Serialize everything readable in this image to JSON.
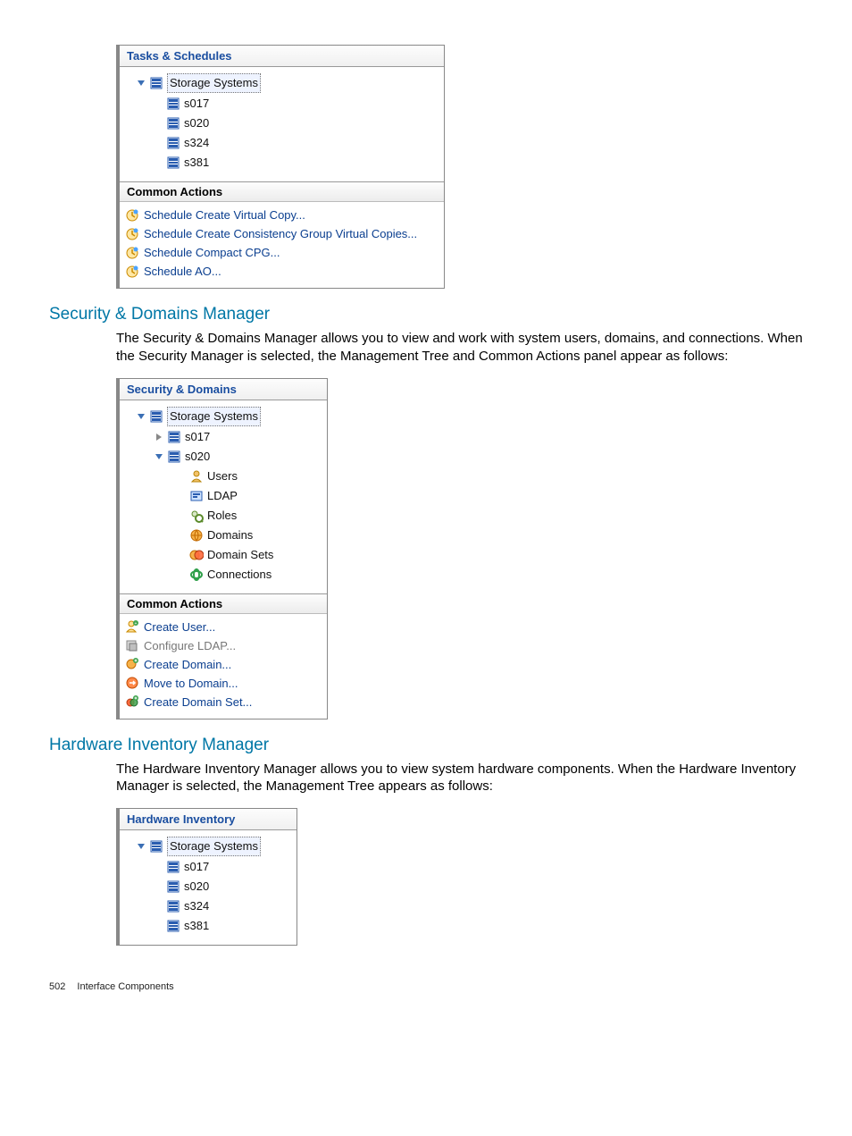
{
  "panel1": {
    "title": "Tasks & Schedules",
    "root": "Storage Systems",
    "children": [
      "s017",
      "s020",
      "s324",
      "s381"
    ],
    "actions_title": "Common Actions",
    "actions": [
      "Schedule Create Virtual Copy...",
      "Schedule Create Consistency Group Virtual Copies...",
      "Schedule Compact CPG...",
      "Schedule AO..."
    ]
  },
  "heading1": "Security & Domains Manager",
  "para1": "The Security & Domains Manager allows you to view and work with system users, domains, and connections. When the Security Manager is selected, the Management Tree and Common Actions panel appear as follows:",
  "panel2": {
    "title": "Security & Domains",
    "root": "Storage Systems",
    "child1": "s017",
    "child2": "s020",
    "sub": [
      "Users",
      "LDAP",
      "Roles",
      "Domains",
      "Domain Sets",
      "Connections"
    ],
    "actions_title": "Common Actions",
    "actions": [
      {
        "label": "Create User...",
        "disabled": false
      },
      {
        "label": "Configure LDAP...",
        "disabled": true
      },
      {
        "label": "Create Domain...",
        "disabled": false
      },
      {
        "label": "Move to Domain...",
        "disabled": false
      },
      {
        "label": "Create Domain Set...",
        "disabled": false
      }
    ]
  },
  "heading2": "Hardware Inventory Manager",
  "para2": "The Hardware Inventory Manager allows you to view system hardware components. When the Hardware Inventory Manager is selected, the Management Tree appears as follows:",
  "panel3": {
    "title": "Hardware Inventory",
    "root": "Storage Systems",
    "children": [
      "s017",
      "s020",
      "s324",
      "s381"
    ]
  },
  "footer": {
    "page": "502",
    "chapter": "Interface Components"
  }
}
